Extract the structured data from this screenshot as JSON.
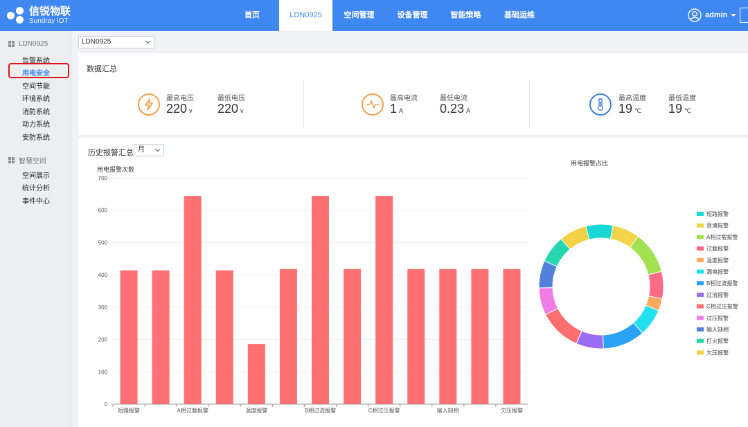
{
  "brand": {
    "name_cn": "信锐物联",
    "name_en": "Sundray IOT"
  },
  "nav": {
    "items": [
      {
        "label": "首页",
        "active": false
      },
      {
        "label": "LDN0925",
        "active": true
      },
      {
        "label": "空间管理",
        "active": false
      },
      {
        "label": "设备管理",
        "active": false
      },
      {
        "label": "智能策略",
        "active": false
      },
      {
        "label": "基础运维",
        "active": false
      }
    ]
  },
  "user": {
    "name": "admin"
  },
  "sidebar": {
    "group1": {
      "label": "LDN0925",
      "icon": "layout-grid-icon"
    },
    "group1_items": [
      "告警系统",
      "用电安全",
      "空间节能",
      "环境系统",
      "消防系统",
      "动力系统",
      "安防系统"
    ],
    "active_item": "用电安全",
    "group2": {
      "label": "智慧空间",
      "icon": "grid-icon"
    },
    "group2_items": [
      "空间展示",
      "统计分析",
      "事件中心"
    ]
  },
  "device_select": {
    "value": "LDN0925"
  },
  "summary": {
    "title": "数据汇总",
    "voltage": {
      "icon": "lightning-icon",
      "max_label": "最高电压",
      "max_value": "220",
      "min_label": "最低电压",
      "min_value": "220",
      "unit": "v"
    },
    "current": {
      "icon": "pulse-icon",
      "max_label": "最高电流",
      "max_value": "1",
      "min_label": "最低电流",
      "min_value": "0.23",
      "unit": "A"
    },
    "temperature": {
      "icon": "thermometer-icon",
      "max_label": "最高温度",
      "max_value": "19",
      "min_label": "最低温度",
      "min_value": "19",
      "unit": "℃"
    }
  },
  "history": {
    "title": "历史报警汇总",
    "period_select": "月",
    "bar_title": "用电报警次数",
    "pie_title": "用电报警占比"
  },
  "colors": {
    "primary": "#3f87f1",
    "bar": "#fd7073",
    "highlight": "#e0151b",
    "orange_icon": "#f0a14a",
    "blue_icon": "#3f7fd6"
  },
  "chart_data": [
    {
      "type": "bar",
      "title": "用电报警次数",
      "categories": [
        "短路报警",
        "浪涌报警",
        "A相过载报警",
        "过载报警",
        "温度报警",
        "漏电报警",
        "B相过流报警",
        "过流报警",
        "C相过压报警",
        "过压报警",
        "输入缺相",
        "打火报警",
        "欠压报警"
      ],
      "tick_labels_shown": [
        "短路报警",
        "A相过载报警",
        "温度报警",
        "B相过流报警",
        "C相过压报警",
        "输入缺相",
        "欠压报警"
      ],
      "values": [
        414,
        414,
        644,
        414,
        186,
        418,
        644,
        418,
        644,
        418,
        418,
        418,
        418
      ],
      "ylim": [
        0,
        700
      ],
      "yticks": [
        0,
        100,
        200,
        300,
        400,
        500,
        600,
        700
      ],
      "grid": true
    },
    {
      "type": "pie",
      "title": "用电报警占比",
      "donut": true,
      "legend_position": "right",
      "labels": [
        "短路报警",
        "浪涌报警",
        "A相过载报警",
        "过载报警",
        "温度报警",
        "漏电报警",
        "B相过流报警",
        "过流报警",
        "C相过压报警",
        "过压报警",
        "输入缺相",
        "打火报警",
        "欠压报警"
      ],
      "values": [
        414,
        414,
        644,
        414,
        186,
        418,
        644,
        418,
        644,
        418,
        418,
        418,
        418
      ],
      "colors": [
        "#17d8d3",
        "#f1d447",
        "#a2e14f",
        "#fd6b86",
        "#fca95f",
        "#23e0ef",
        "#2aa2f6",
        "#9a6cf3",
        "#fd6e6e",
        "#f07de6",
        "#5281dc",
        "#27d5b0",
        "#f3d145"
      ]
    }
  ]
}
